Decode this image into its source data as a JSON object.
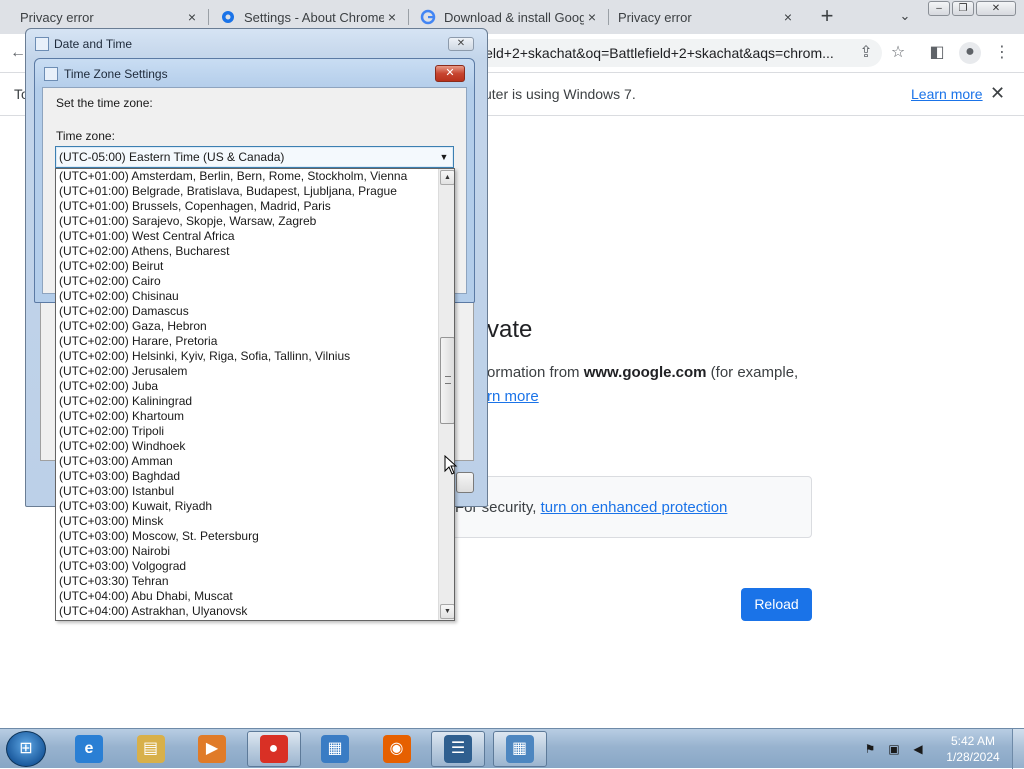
{
  "browser": {
    "tabs": [
      {
        "title": "Privacy error",
        "state": "inactive"
      },
      {
        "title": "Settings - About Chrome",
        "state": "inactive"
      },
      {
        "title": "Download & install Goog",
        "state": "inactive"
      },
      {
        "title": "Privacy error",
        "state": "active"
      }
    ],
    "tab_close_glyph": "×",
    "new_tab_glyph": "+",
    "tab_search_glyph": "⌄",
    "address_bar": {
      "url": "ield+2+skachat&oq=Battlefield+2+skachat&aqs=chrom..."
    },
    "infobar": {
      "text_left": "To",
      "text_right": "uter is using Windows 7.",
      "learn_more": "Learn more",
      "close_glyph": "✕"
    }
  },
  "page": {
    "heading_fragment": "vate",
    "body_before": "ormation from ",
    "body_bold": "www.google.com",
    "body_after": " (for example,",
    "learn_more_fragment": "rn more",
    "safe_text": "For security, ",
    "safe_link": "turn on enhanced protection",
    "reload_label": "Reload",
    "accent_color": "#1a73e8"
  },
  "dialogs": {
    "date_time": {
      "title": "Date and Time",
      "close_glyph": "✕"
    },
    "time_zone": {
      "title": "Time Zone Settings",
      "close_glyph": "✕",
      "set_label": "Set the time zone:",
      "zone_label": "Time zone:",
      "selected": "(UTC-05:00) Eastern Time (US & Canada)",
      "options": [
        "(UTC+01:00) Amsterdam, Berlin, Bern, Rome, Stockholm, Vienna",
        "(UTC+01:00) Belgrade, Bratislava, Budapest, Ljubljana, Prague",
        "(UTC+01:00) Brussels, Copenhagen, Madrid, Paris",
        "(UTC+01:00) Sarajevo, Skopje, Warsaw, Zagreb",
        "(UTC+01:00) West Central Africa",
        "(UTC+02:00) Athens, Bucharest",
        "(UTC+02:00) Beirut",
        "(UTC+02:00) Cairo",
        "(UTC+02:00) Chisinau",
        "(UTC+02:00) Damascus",
        "(UTC+02:00) Gaza, Hebron",
        "(UTC+02:00) Harare, Pretoria",
        "(UTC+02:00) Helsinki, Kyiv, Riga, Sofia, Tallinn, Vilnius",
        "(UTC+02:00) Jerusalem",
        "(UTC+02:00) Juba",
        "(UTC+02:00) Kaliningrad",
        "(UTC+02:00) Khartoum",
        "(UTC+02:00) Tripoli",
        "(UTC+02:00) Windhoek",
        "(UTC+03:00) Amman",
        "(UTC+03:00) Baghdad",
        "(UTC+03:00) Istanbul",
        "(UTC+03:00) Kuwait, Riyadh",
        "(UTC+03:00) Minsk",
        "(UTC+03:00) Moscow, St. Petersburg",
        "(UTC+03:00) Nairobi",
        "(UTC+03:00) Volgograd",
        "(UTC+03:30) Tehran",
        "(UTC+04:00) Abu Dhabi, Muscat",
        "(UTC+04:00) Astrakhan, Ulyanovsk"
      ]
    }
  },
  "taskbar": {
    "apps": [
      {
        "name": "internet-explorer",
        "glyph": "e",
        "color": "#2a7fd4",
        "open": false
      },
      {
        "name": "windows-explorer",
        "glyph": "▤",
        "color": "#d8b04a",
        "open": false
      },
      {
        "name": "media-player",
        "glyph": "▶",
        "color": "#e07b28",
        "open": false
      },
      {
        "name": "chrome",
        "glyph": "●",
        "color": "#d93025",
        "open": true
      },
      {
        "name": "control-panel",
        "glyph": "▦",
        "color": "#3a7cc4",
        "open": false
      },
      {
        "name": "firefox",
        "glyph": "◉",
        "color": "#e66000",
        "open": false
      },
      {
        "name": "notepad-list",
        "glyph": "☰",
        "color": "#2f5f8f",
        "open": true
      },
      {
        "name": "date-time",
        "glyph": "▦",
        "color": "#4d86c0",
        "open": true
      }
    ],
    "clock_time": "5:42 AM",
    "clock_date": "1/28/2024"
  }
}
